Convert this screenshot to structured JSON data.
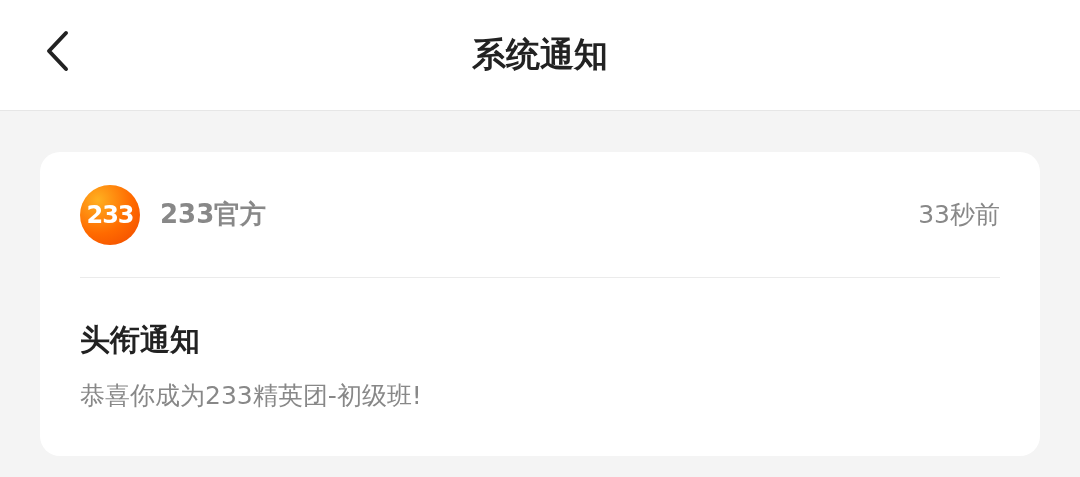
{
  "header": {
    "title": "系统通知"
  },
  "notification": {
    "sender_logo_text": "233",
    "sender": "233官方",
    "time": "33秒前",
    "title": "头衔通知",
    "body": "恭喜你成为233精英团-初级班!"
  }
}
